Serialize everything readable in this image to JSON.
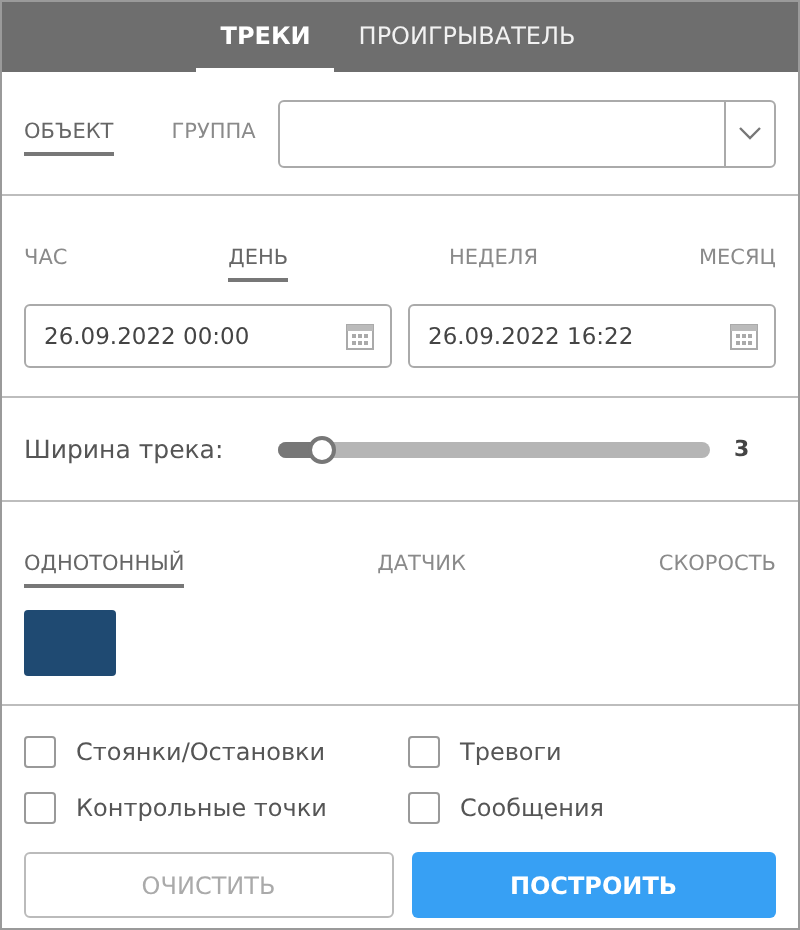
{
  "tabs": [
    {
      "label": "ТРЕКИ",
      "selected": true
    },
    {
      "label": "ПРОИГРЫВАТЕЛЬ",
      "selected": false
    }
  ],
  "target_modes": [
    {
      "label": "ОБЪЕКТ",
      "selected": true
    },
    {
      "label": "ГРУППА",
      "selected": false
    }
  ],
  "periods": [
    {
      "label": "ЧАС",
      "selected": false
    },
    {
      "label": "ДЕНЬ",
      "selected": true
    },
    {
      "label": "НЕДЕЛЯ",
      "selected": false
    },
    {
      "label": "МЕСЯЦ",
      "selected": false
    }
  ],
  "date_from": {
    "value": "26.09.2022 00:00"
  },
  "date_to": {
    "value": "26.09.2022 16:22"
  },
  "track_width": {
    "label": "Ширина трека:",
    "level": 0.1,
    "reading": "3"
  },
  "color_modes": [
    {
      "label": "ОДНОТОННЫЙ",
      "selected": true
    },
    {
      "label": "ДАТЧИК",
      "selected": false
    },
    {
      "label": "СКОРОСТЬ",
      "selected": false
    }
  ],
  "track_color": {
    "color": "#1f4a72"
  },
  "options": [
    {
      "label": "Стоянки/Остановки",
      "checked": false
    },
    {
      "label": "Тревоги",
      "checked": false
    },
    {
      "label": "Контрольные точки",
      "checked": false
    },
    {
      "label": "Сообщения",
      "checked": false
    }
  ],
  "buttons": [
    {
      "label": "ОЧИСТИТЬ",
      "kind": "secondary",
      "disabled": true
    },
    {
      "label": "ПОСТРОИТЬ",
      "kind": "primary",
      "disabled": false
    }
  ]
}
